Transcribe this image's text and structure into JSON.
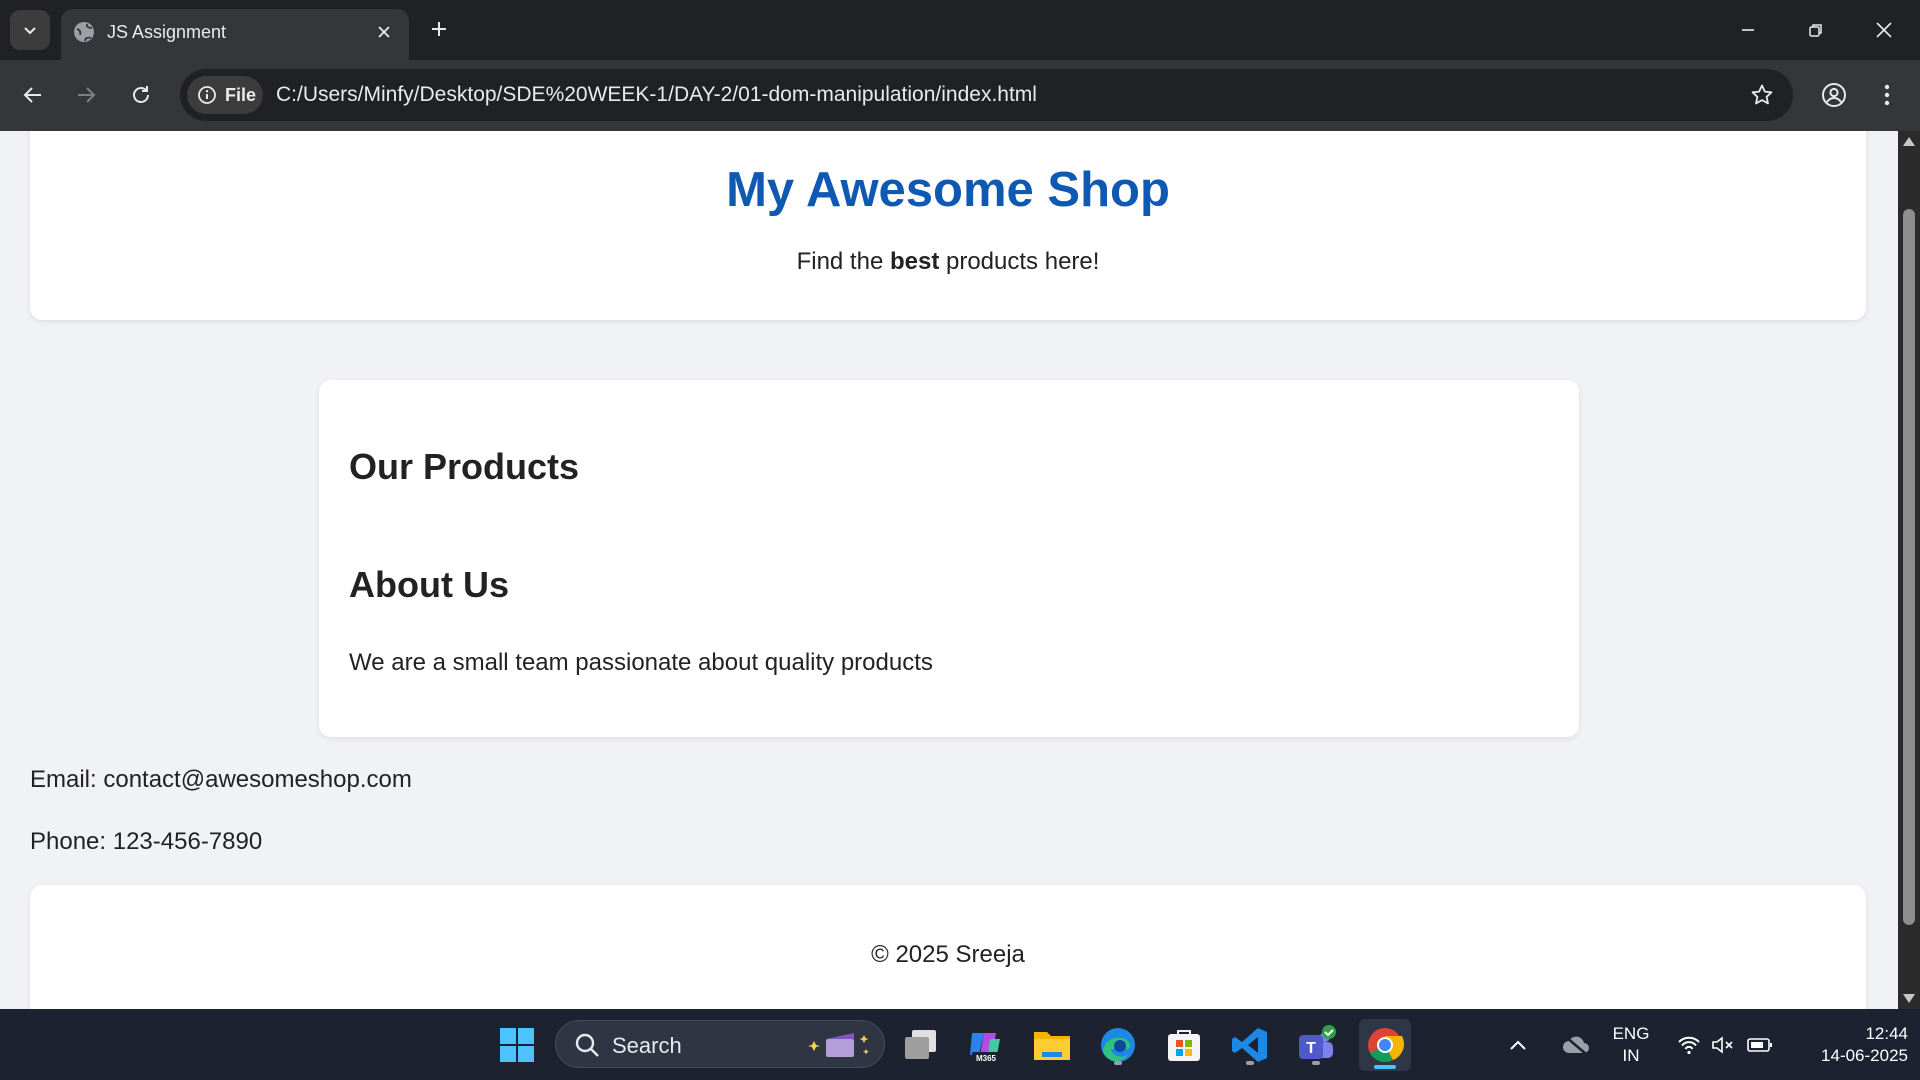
{
  "browser": {
    "tab": {
      "title": "JS Assignment",
      "favicon": "globe-icon"
    },
    "address": {
      "chip_label": "File",
      "url": "C:/Users/Minfy/Desktop/SDE%20WEEK-1/DAY-2/01-dom-manipulation/index.html"
    },
    "colors": {
      "tabstrip": "#202124",
      "toolbar": "#35363a",
      "omnibox": "#202124"
    }
  },
  "page": {
    "header": {
      "title": "My Awesome Shop",
      "tagline_prefix": "Find the ",
      "tagline_bold": "best",
      "tagline_suffix": " products here!"
    },
    "main": {
      "products_heading": "Our Products",
      "about_heading": "About Us",
      "about_text": "We are a small team passionate about quality products"
    },
    "contact": {
      "email": "Email: contact@awesomeshop.com",
      "phone": "Phone: 123-456-7890"
    },
    "footer": {
      "copyright": "© 2025 Sreeja"
    },
    "colors": {
      "title": "#1059b3",
      "background": "#f1f2f5",
      "card": "#ffffff"
    }
  },
  "taskbar": {
    "search_label": "Search",
    "apps": [
      "windows-start-icon",
      "task-view-icon",
      "m365-copilot-icon",
      "file-explorer-icon",
      "edge-icon",
      "microsoft-store-icon",
      "vscode-icon",
      "teams-icon",
      "chrome-icon"
    ],
    "m365_badge": "M365",
    "language": "ENG",
    "region": "IN",
    "time": "12:44",
    "date": "14-06-2025"
  }
}
